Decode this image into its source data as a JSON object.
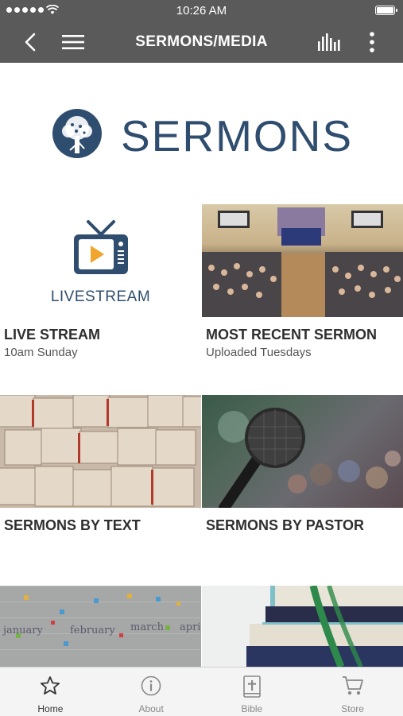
{
  "status_bar": {
    "time": "10:26 AM"
  },
  "header": {
    "title": "SERMONS/MEDIA"
  },
  "banner": {
    "title": "SERMONS"
  },
  "tiles": [
    {
      "label": "LIVE STREAM",
      "sub": "10am Sunday",
      "image_caption": "LIVESTREAM"
    },
    {
      "label": "MOST RECENT SERMON",
      "sub": "Uploaded Tuesdays"
    },
    {
      "label": "SERMONS BY TEXT",
      "sub": ""
    },
    {
      "label": "SERMONS BY PASTOR",
      "sub": ""
    },
    {
      "label": "",
      "sub": "",
      "image_words": [
        "january",
        "february",
        "march",
        "april"
      ]
    },
    {
      "label": "",
      "sub": ""
    }
  ],
  "tabbar": {
    "items": [
      {
        "label": "Home",
        "icon": "star-icon",
        "active": true
      },
      {
        "label": "About",
        "icon": "info-icon",
        "active": false
      },
      {
        "label": "Bible",
        "icon": "bible-icon",
        "active": false
      },
      {
        "label": "Store",
        "icon": "cart-icon",
        "active": false
      }
    ]
  },
  "colors": {
    "header_bg": "#5a5a5a",
    "brand_navy": "#2f4d6e",
    "tabbar_bg": "#f4f4f4"
  }
}
